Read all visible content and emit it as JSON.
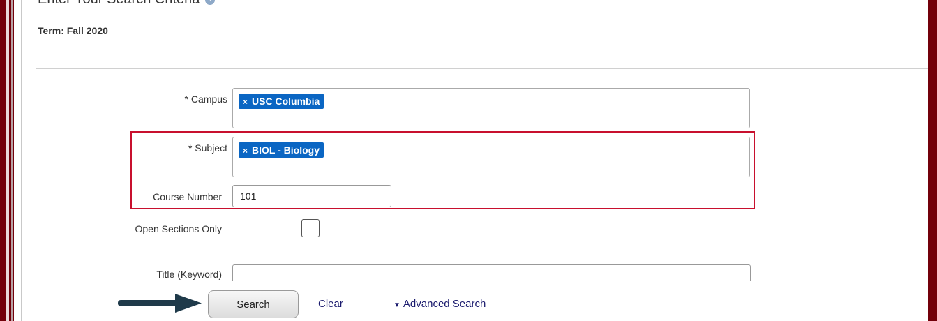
{
  "header": {
    "title": "Enter Your Search Criteria",
    "info_icon": "i",
    "term": "Term: Fall 2020"
  },
  "form": {
    "campus": {
      "label": "* Campus",
      "chip": "USC Columbia",
      "remove_icon": "×"
    },
    "subject": {
      "label": "* Subject",
      "chip": "BIOL - Biology",
      "remove_icon": "×"
    },
    "course_number": {
      "label": "Course Number",
      "value": "101"
    },
    "open_sections": {
      "label": "Open Sections Only",
      "checked": false
    },
    "title_keyword": {
      "label": "Title (Keyword)",
      "value": ""
    }
  },
  "footer": {
    "search_label": "Search",
    "clear_label": "Clear",
    "advanced_caret": "▼",
    "advanced_label": "Advanced Search"
  },
  "colors": {
    "frame": "#73000a",
    "chip": "#0b66c3",
    "highlight": "#c8102e",
    "arrow": "#1f3a4a"
  }
}
